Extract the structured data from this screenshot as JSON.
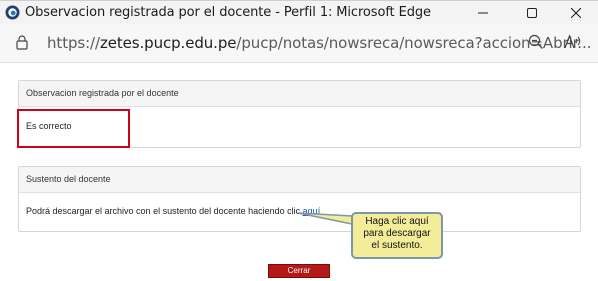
{
  "window": {
    "title": "Observacion registrada por el docente - Perfil 1: Microsoft Edge"
  },
  "address_bar": {
    "scheme": "https://",
    "host": "zetes.pucp.edu.pe",
    "path": "/pucp/notas/nowsreca/nowsreca?accion=Abrir..."
  },
  "observation_panel": {
    "header": "Observacion registrada por el docente",
    "text": "Es correcto"
  },
  "support_panel": {
    "header": "Sustento del docente",
    "text": "Podrá descargar el archivo con el sustento del docente haciendo clic ",
    "link_label": "aquí"
  },
  "callout": {
    "line1": "Haga clic aquí",
    "line2": "para descargar",
    "line3": "el sustento."
  },
  "close_button": {
    "label": "Cerrar"
  },
  "colors": {
    "highlight_border": "#d0021b",
    "close_button": "#b41818",
    "callout_fill": "#f3ed9a",
    "link": "#1a55b5"
  },
  "icons": [
    "edge-app-icon",
    "minimize-icon",
    "maximize-icon",
    "close-icon",
    "lock-icon",
    "zoom-out-icon",
    "read-aloud-icon"
  ]
}
